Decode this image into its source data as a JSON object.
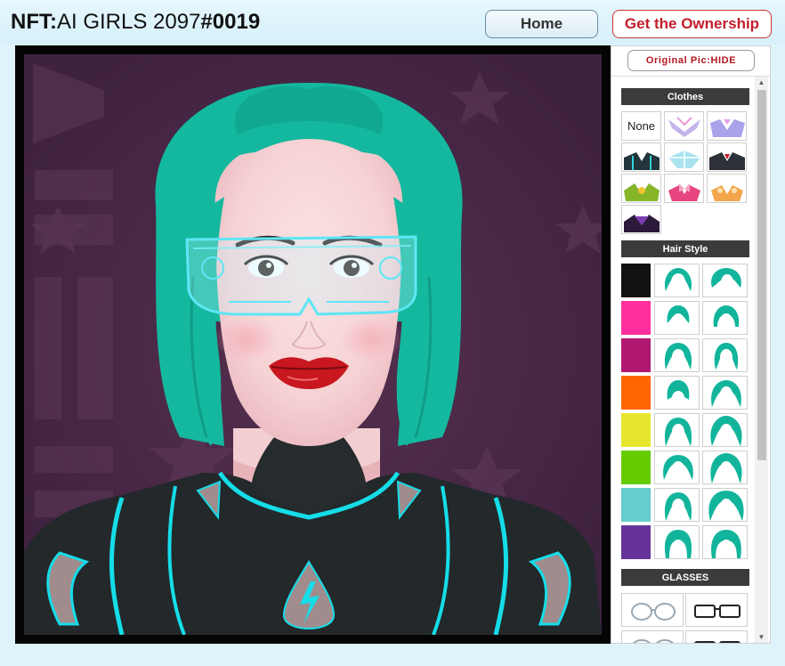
{
  "header": {
    "title_prefix": "NFT:",
    "title_name": "AI GIRLS 2097",
    "title_hash": "#",
    "title_number": "0019",
    "home_label": "Home",
    "ownership_label": "Get the Ownership"
  },
  "panel": {
    "original_pic_label": "Original Pic:HIDE",
    "clothes": {
      "heading": "Clothes",
      "none_label": "None",
      "items": [
        {
          "name": "clothes-lavender-collar",
          "color": "#c4b4ec"
        },
        {
          "name": "clothes-lilac-armor",
          "color": "#a9a3ea"
        },
        {
          "name": "clothes-black-teal-suit",
          "color": "#23353c"
        },
        {
          "name": "clothes-ice-crystal",
          "color": "#a9e3ee"
        },
        {
          "name": "clothes-black-red-suit",
          "color": "#2c3237"
        },
        {
          "name": "clothes-green-gold",
          "color": "#86b52a"
        },
        {
          "name": "clothes-pink-bow",
          "color": "#e6457f"
        },
        {
          "name": "clothes-orange-floral",
          "color": "#f2a54a"
        },
        {
          "name": "clothes-purple-dark",
          "color": "#5b2a7d"
        }
      ]
    },
    "hair": {
      "heading": "Hair Style",
      "colors": [
        "#111111",
        "#ff2f9e",
        "#b1176f",
        "#ff6600",
        "#e6e62f",
        "#66cc00",
        "#66cccc",
        "#663399"
      ],
      "style_color": "#12b59c"
    },
    "glasses": {
      "heading": "GLASSES"
    }
  }
}
